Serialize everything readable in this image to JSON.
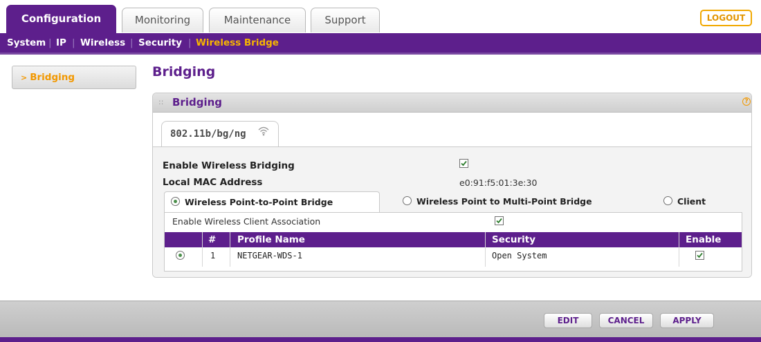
{
  "tabs": [
    {
      "label": "Configuration",
      "active": true
    },
    {
      "label": "Monitoring",
      "active": false
    },
    {
      "label": "Maintenance",
      "active": false
    },
    {
      "label": "Support",
      "active": false
    }
  ],
  "logout_label": "LOGOUT",
  "subnav": [
    {
      "label": "System"
    },
    {
      "label": "IP"
    },
    {
      "label": "Wireless"
    },
    {
      "label": "Security"
    },
    {
      "label": "Wireless Bridge",
      "current": true
    }
  ],
  "sidebar": {
    "items": [
      {
        "label": "Bridging"
      }
    ]
  },
  "page_title": "Bridging",
  "section": {
    "title": "Bridging",
    "radio_tab": "802.11b/bg/ng",
    "enable_bridging": {
      "label": "Enable Wireless Bridging",
      "checked": true
    },
    "local_mac": {
      "label": "Local MAC Address",
      "value": "e0:91:f5:01:3e:30"
    },
    "modes": [
      {
        "label": "Wireless Point-to-Point Bridge",
        "selected": true
      },
      {
        "label": "Wireless Point to Multi-Point Bridge",
        "selected": false
      },
      {
        "label": "Client",
        "selected": false
      }
    ],
    "client_assoc": {
      "label": "Enable Wireless Client Association",
      "checked": true
    },
    "table": {
      "headers": [
        "#",
        "Profile Name",
        "Security",
        "Enable"
      ],
      "rows": [
        {
          "selected": true,
          "num": "1",
          "profile": "NETGEAR-WDS-1",
          "security": "Open System",
          "enabled": true
        }
      ]
    }
  },
  "buttons": {
    "edit": "EDIT",
    "cancel": "CANCEL",
    "apply": "APPLY"
  },
  "colors": {
    "brand_purple": "#5d1f8c",
    "accent_orange": "#f29800"
  }
}
